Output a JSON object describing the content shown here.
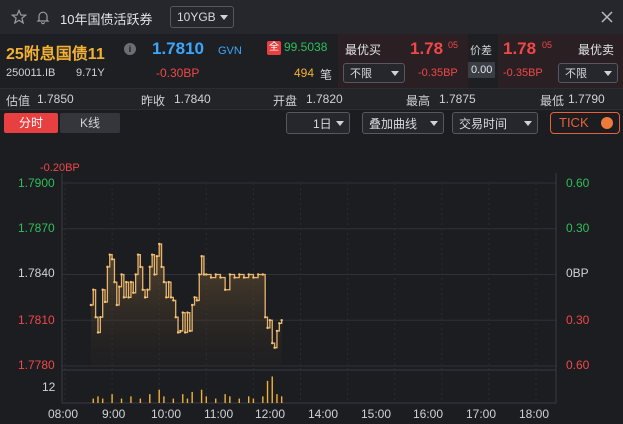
{
  "titlebar": {
    "title": "10年国债活跃券",
    "dropdown_value": "10YGB",
    "icons": [
      "star-icon",
      "bell-icon",
      "close-icon"
    ]
  },
  "quote": {
    "name": "25附息国债11",
    "info_icon": "info-icon",
    "price": "1.7810",
    "source": "GVN",
    "full_badge": "全",
    "full_price": "99.5038",
    "code": "250011.IB",
    "term": "9.71Y",
    "change": "-0.30BP",
    "volume": "494",
    "volume_unit": "笔",
    "best_bid_label": "最优买",
    "bid_filter": "不限",
    "bid_price_main": "1.78",
    "bid_price_sup": "05",
    "bid_change": "-0.35BP",
    "spread_label": "价差",
    "spread_value": "0.00",
    "ask_price_main": "1.78",
    "ask_price_sup": "05",
    "ask_change": "-0.35BP",
    "best_ask_label": "最优卖",
    "ask_filter": "不限"
  },
  "stats": [
    {
      "label": "估值",
      "value": "1.7850"
    },
    {
      "label": "昨收",
      "value": "1.7840"
    },
    {
      "label": "开盘",
      "value": "1.7820"
    },
    {
      "label": "最高",
      "value": "1.7875"
    },
    {
      "label": "最低",
      "value": "1.7790"
    }
  ],
  "tabs": {
    "intraday": "分时",
    "kline": "K线",
    "period": "1日",
    "overlay": "叠加曲线",
    "trade_time": "交易时间",
    "tick": "TICK"
  },
  "colors": {
    "up": "#f04848",
    "down": "#2fbf5a",
    "accent": "#f2b134",
    "line": "#e8b46a",
    "active_tab": "#e84040"
  },
  "chart_data": {
    "type": "line",
    "top_change_label": "-0.20BP",
    "y_left_ticks": [
      "1.7900",
      "1.7870",
      "1.7840",
      "1.7810",
      "1.7780"
    ],
    "y_right_ticks": [
      "0.60",
      "0.30",
      "0BP",
      "0.30",
      "0.60"
    ],
    "ylim": [
      1.778,
      1.79
    ],
    "x_ticks": [
      "08:00",
      "9:00",
      "10:00",
      "11:00",
      "12:00",
      "14:00",
      "15:00",
      "16:00",
      "17:00",
      "18:00"
    ],
    "volume_tick": "12",
    "series": [
      {
        "values": [
          [
            8.55,
            1.782
          ],
          [
            8.6,
            1.783
          ],
          [
            8.65,
            1.7812
          ],
          [
            8.7,
            1.7802
          ],
          [
            8.75,
            1.7812
          ],
          [
            8.8,
            1.783
          ],
          [
            8.85,
            1.7822
          ],
          [
            8.9,
            1.7845
          ],
          [
            8.95,
            1.7853
          ],
          [
            9.0,
            1.785
          ],
          [
            9.05,
            1.7835
          ],
          [
            9.1,
            1.782
          ],
          [
            9.15,
            1.7832
          ],
          [
            9.2,
            1.784
          ],
          [
            9.25,
            1.7825
          ],
          [
            9.3,
            1.7835
          ],
          [
            9.35,
            1.7825
          ],
          [
            9.4,
            1.7835
          ],
          [
            9.45,
            1.7828
          ],
          [
            9.5,
            1.784
          ],
          [
            9.55,
            1.7853
          ],
          [
            9.6,
            1.7845
          ],
          [
            9.65,
            1.783
          ],
          [
            9.7,
            1.7825
          ],
          [
            9.75,
            1.783
          ],
          [
            9.8,
            1.7845
          ],
          [
            9.85,
            1.7853
          ],
          [
            9.9,
            1.784
          ],
          [
            9.95,
            1.7852
          ],
          [
            10.0,
            1.786
          ],
          [
            10.05,
            1.7845
          ],
          [
            10.1,
            1.7835
          ],
          [
            10.15,
            1.7825
          ],
          [
            10.2,
            1.7835
          ],
          [
            10.25,
            1.7825
          ],
          [
            10.3,
            1.7823
          ],
          [
            10.35,
            1.7812
          ],
          [
            10.4,
            1.7802
          ],
          [
            10.45,
            1.7803
          ],
          [
            10.5,
            1.7815
          ],
          [
            10.55,
            1.7802
          ],
          [
            10.6,
            1.7815
          ],
          [
            10.65,
            1.7803
          ],
          [
            10.7,
            1.782
          ],
          [
            10.75,
            1.7825
          ],
          [
            10.8,
            1.7823
          ],
          [
            10.85,
            1.784
          ],
          [
            10.9,
            1.7852
          ],
          [
            10.95,
            1.784
          ],
          [
            11.0,
            1.784
          ],
          [
            11.1,
            1.7838
          ],
          [
            11.2,
            1.784
          ],
          [
            11.3,
            1.7838
          ],
          [
            11.4,
            1.783
          ],
          [
            11.5,
            1.784
          ],
          [
            11.6,
            1.7838
          ],
          [
            11.7,
            1.784
          ],
          [
            11.8,
            1.7838
          ],
          [
            11.9,
            1.784
          ],
          [
            12.0,
            1.7838
          ],
          [
            12.1,
            1.784
          ],
          [
            12.2,
            1.784
          ],
          [
            12.25,
            1.7812
          ],
          [
            12.3,
            1.7805
          ],
          [
            12.35,
            1.781
          ],
          [
            12.4,
            1.7795
          ],
          [
            12.45,
            1.7792
          ],
          [
            12.5,
            1.7803
          ],
          [
            12.55,
            1.7808
          ],
          [
            12.6,
            1.781
          ]
        ]
      }
    ],
    "volume": [
      [
        8.6,
        2
      ],
      [
        8.7,
        3
      ],
      [
        8.8,
        2
      ],
      [
        9.0,
        4
      ],
      [
        9.2,
        2
      ],
      [
        9.4,
        3
      ],
      [
        9.6,
        2
      ],
      [
        9.8,
        4
      ],
      [
        10.0,
        6
      ],
      [
        10.1,
        3
      ],
      [
        10.3,
        2
      ],
      [
        10.5,
        4
      ],
      [
        10.6,
        2
      ],
      [
        10.7,
        5
      ],
      [
        10.9,
        6
      ],
      [
        11.0,
        3
      ],
      [
        11.2,
        2
      ],
      [
        11.4,
        4
      ],
      [
        11.5,
        3
      ],
      [
        11.7,
        2
      ],
      [
        11.9,
        3
      ],
      [
        12.0,
        2
      ],
      [
        12.2,
        3
      ],
      [
        12.3,
        10
      ],
      [
        12.4,
        12
      ],
      [
        12.5,
        4
      ],
      [
        12.6,
        3
      ]
    ]
  }
}
